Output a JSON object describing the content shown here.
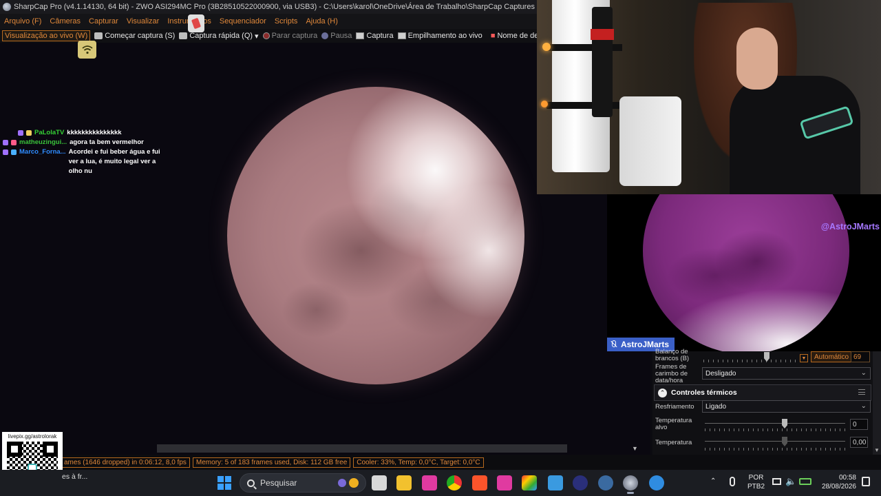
{
  "window": {
    "title": "SharpCap Pro (v4.1.14130, 64 bit) - ZWO ASI294MC Pro (3B28510522000900, via USB3) - C:\\Users\\karol\\OneDrive\\Área de Trabalho\\SharpCap Captures"
  },
  "menu": [
    "Arquivo (F)",
    "Câmeras",
    "Capturar",
    "Visualizar",
    "Instrumentos",
    "Sequenciador",
    "Scripts",
    "Ajuda (H)"
  ],
  "toolbar": {
    "live_view": "Visualização ao vivo (W)",
    "start_capture": "Começar captura (S)",
    "quick_capture": "Captura rápida (Q)",
    "stop_capture": "Parar captura",
    "pause": "Pausa",
    "snapshot": "Captura",
    "live_stack": "Empilhamento ao vivo",
    "target_name": "Nome de destino"
  },
  "chat": [
    {
      "user": "PaLolaTV",
      "user_color": "#36d236",
      "message": "kkkkkkkkkkkkkkk"
    },
    {
      "user": "matheuzingui...",
      "user_color": "#3ac23a",
      "message": "agora ta bem vermelhor"
    },
    {
      "user": "Marco_Forna...",
      "user_color": "#2f8cff",
      "message": "Acordei e fui beber água e fui ver a lua, é muito legal ver a olho nu"
    }
  ],
  "overlay": {
    "handle": "@AstroJMarts",
    "nameplate": "AstroJMarts"
  },
  "controls": {
    "white_balance_label": "Balanço de brancos (B)",
    "white_balance_auto": "Automático",
    "white_balance_value": "69",
    "timestamp_label": "Frames de carimbo de data/hora",
    "timestamp_value": "Desligado",
    "thermal_section": "Controles térmicos",
    "cooling_label": "Resfriamento",
    "cooling_value": "Ligado",
    "target_temp_label": "Temperatura alvo",
    "target_temp_value": "0",
    "temperature_label": "Temperatura",
    "temperature_value": "0,00"
  },
  "status": {
    "frames": "ames (1646 dropped) in 0:06:12, 8,0 fps",
    "memory": "Memory: 5 of 183 frames used, Disk: 112 GB free",
    "cooler": "Cooler: 33%, Temp: 0,0°C, Target: 0,0°C"
  },
  "qr": {
    "label": "livepix.gg/astrolorak"
  },
  "taskbar": {
    "notification": "es à fr...",
    "search_placeholder": "Pesquisar",
    "lang_line1": "POR",
    "lang_line2": "PTB2",
    "time": "00:58",
    "date": "28/08/2026"
  },
  "colors": {
    "accent": "#e0883a",
    "moon_tint": "#a97b80",
    "overlay_moon": "#7c2a7c",
    "handle": "#a678ff",
    "nameplate_bg": "#3a5fc7"
  }
}
